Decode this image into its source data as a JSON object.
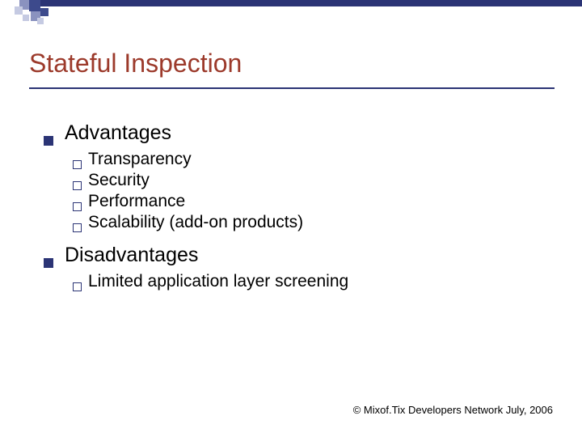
{
  "title": "Stateful Inspection",
  "sections": [
    {
      "heading": "Advantages",
      "items": [
        "Transparency",
        "Security",
        "Performance",
        "Scalability (add-on products)"
      ]
    },
    {
      "heading": "Disadvantages",
      "items": [
        "Limited application layer screening"
      ]
    }
  ],
  "footer": "© Mixof.Tix Developers Network July, 2006"
}
